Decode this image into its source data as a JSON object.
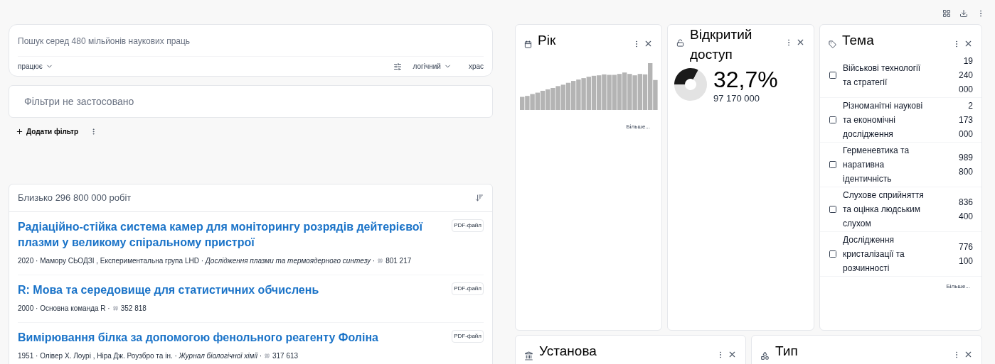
{
  "search": {
    "placeholder": "Пошук серед 480 мільйонів наукових праць",
    "scope": "працює",
    "mode": "логічний",
    "extra": "храс"
  },
  "filters": {
    "empty_text": "Фільтри не застосовано",
    "add_label": "Додати фільтр"
  },
  "results": {
    "count": "Близько 296 800 000 робіт",
    "items": [
      {
        "title": "Радіаційно-стійка система камер для моніторингу розрядів дейтерієвої плазми у великому спіральному пристрої",
        "meta": "2020 · Мамору СЬОДЗІ , Експериментальна група LHD · *Дослідження плазми та термоядерного синтезу* ·",
        "citations": "801 217",
        "badge": "PDF-файл"
      },
      {
        "title": "R: Мова та середовище для статистичних обчислень",
        "meta": "2000 · Основна команда R ·",
        "citations": "352 818",
        "badge": "PDF-файл"
      },
      {
        "title": "Вимірювання білка за допомогою фенольного реагенту Фоліна",
        "meta": "1951 · Олівер Х. Лоурі , Ніра Дж. Роузбро та ін. · *Журнал біологічної хімії* ·",
        "citations": "317 613",
        "badge": "PDF-файл"
      }
    ]
  },
  "year_card": {
    "title": "Рік",
    "more": "Більше..."
  },
  "open_access_card": {
    "title": "Відкритий доступ",
    "percent": "32,7%",
    "count": "97 170 000",
    "chart_data": {
      "type": "donut",
      "values": [
        32.7,
        67.3
      ]
    }
  },
  "topic_card": {
    "title": "Тема",
    "more": "Більше...",
    "items": [
      {
        "label": "Військові технології та стратегії",
        "count": "19 240 000",
        "checked": false
      },
      {
        "label": "Різноманітні наукові та економічні дослідження",
        "count": "2 173 000",
        "checked": false
      },
      {
        "label": "Герменевтика та наративна ідентичність",
        "count": "989 800",
        "checked": false
      },
      {
        "label": "Слухове сприйняття та оцінка людським слухом",
        "count": "836 400",
        "checked": false
      },
      {
        "label": "Дослідження кристалізації та розчинності",
        "count": "776 100",
        "checked": false
      }
    ]
  },
  "bottom_cards": [
    {
      "title": "Установа",
      "kind": "institution"
    },
    {
      "title": "Тип",
      "kind": "type"
    }
  ]
}
